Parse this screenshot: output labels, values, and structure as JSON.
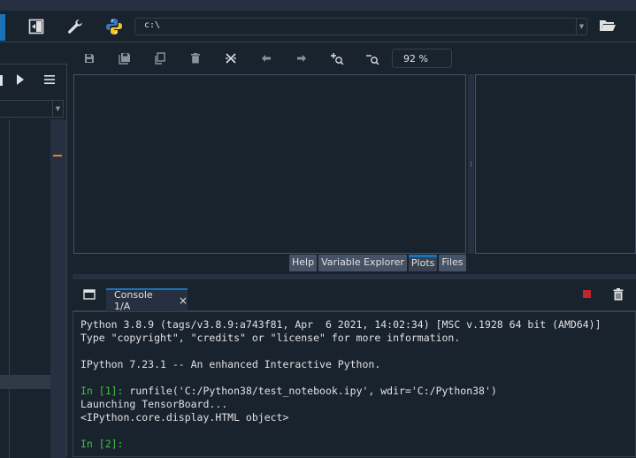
{
  "toolbar": {
    "path_value": "c:\\"
  },
  "plots": {
    "zoom_value": "92 %",
    "tabs": [
      {
        "label": "Help",
        "active": false
      },
      {
        "label": "Variable Explorer",
        "active": false
      },
      {
        "label": "Plots",
        "active": true
      },
      {
        "label": "Files",
        "active": false
      }
    ]
  },
  "console": {
    "tab_label": "Console 1/A",
    "close_glyph": "×",
    "lines": [
      {
        "text": "Python 3.8.9 (tags/v3.8.9:a743f81, Apr  6 2021, 14:02:34) [MSC v.1928 64 bit (AMD64)]",
        "prompt": ""
      },
      {
        "text": "Type \"copyright\", \"credits\" or \"license\" for more information.",
        "prompt": ""
      },
      {
        "text": "",
        "prompt": ""
      },
      {
        "text": "IPython 7.23.1 -- An enhanced Interactive Python.",
        "prompt": ""
      },
      {
        "text": "",
        "prompt": ""
      },
      {
        "text": " runfile('C:/Python38/test_notebook.ipy', wdir='C:/Python38')",
        "prompt": "In [1]:"
      },
      {
        "text": "Launching TensorBoard...",
        "prompt": ""
      },
      {
        "text": "<IPython.core.display.HTML object>",
        "prompt": ""
      },
      {
        "text": "",
        "prompt": ""
      },
      {
        "text": "",
        "prompt": "In [2]:"
      }
    ]
  },
  "colors": {
    "accent": "#1a72bb",
    "background": "#19232d",
    "prompt": "#3fc13f",
    "stop": "#c0272d",
    "marker": "#e67e22"
  }
}
